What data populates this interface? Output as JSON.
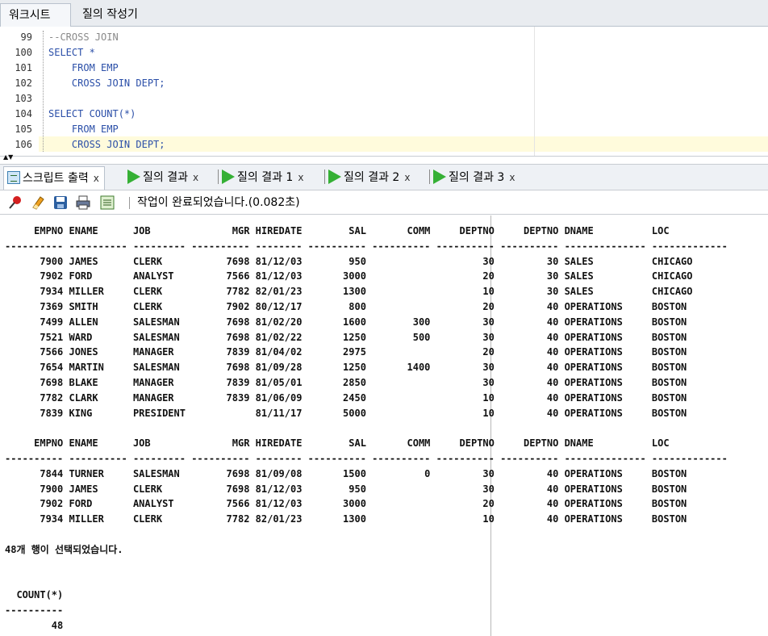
{
  "top_tabs": {
    "worksheet": "워크시트",
    "query_builder": "질의 작성기"
  },
  "editor": {
    "lines": [
      {
        "num": "99",
        "code": "--CROSS JOIN"
      },
      {
        "num": "100",
        "code": "SELECT *"
      },
      {
        "num": "101",
        "code": "    FROM EMP"
      },
      {
        "num": "102",
        "code": "    CROSS JOIN DEPT;"
      },
      {
        "num": "103",
        "code": ""
      },
      {
        "num": "104",
        "code": "SELECT COUNT(*)"
      },
      {
        "num": "105",
        "code": "    FROM EMP"
      },
      {
        "num": "106",
        "code": "    CROSS JOIN DEPT;"
      }
    ]
  },
  "output_tabs": [
    {
      "label": "스크립트 출력",
      "close": "x"
    },
    {
      "label": "질의 결과",
      "close": "x"
    },
    {
      "label": "질의 결과 1",
      "close": "x"
    },
    {
      "label": "질의 결과 2",
      "close": "x"
    },
    {
      "label": "질의 결과 3",
      "close": "x"
    }
  ],
  "toolbar": {
    "status": "작업이 완료되었습니다.(0.082초)"
  },
  "output_lines": [
    "     EMPNO ENAME      JOB              MGR HIREDATE        SAL       COMM     DEPTNO     DEPTNO DNAME          LOC          ",
    "---------- ---------- --------- ---------- -------- ---------- ---------- ---------- ---------- -------------- -------------",
    "      7900 JAMES      CLERK           7698 81/12/03        950                    30         30 SALES          CHICAGO      ",
    "      7902 FORD       ANALYST         7566 81/12/03       3000                    20         30 SALES          CHICAGO      ",
    "      7934 MILLER     CLERK           7782 82/01/23       1300                    10         30 SALES          CHICAGO      ",
    "      7369 SMITH      CLERK           7902 80/12/17        800                    20         40 OPERATIONS     BOSTON       ",
    "      7499 ALLEN      SALESMAN        7698 81/02/20       1600        300         30         40 OPERATIONS     BOSTON       ",
    "      7521 WARD       SALESMAN        7698 81/02/22       1250        500         30         40 OPERATIONS     BOSTON       ",
    "      7566 JONES      MANAGER         7839 81/04/02       2975                    20         40 OPERATIONS     BOSTON       ",
    "      7654 MARTIN     SALESMAN        7698 81/09/28       1250       1400         30         40 OPERATIONS     BOSTON       ",
    "      7698 BLAKE      MANAGER         7839 81/05/01       2850                    30         40 OPERATIONS     BOSTON       ",
    "      7782 CLARK      MANAGER         7839 81/06/09       2450                    10         40 OPERATIONS     BOSTON       ",
    "      7839 KING       PRESIDENT            81/11/17       5000                    10         40 OPERATIONS     BOSTON       ",
    "",
    "     EMPNO ENAME      JOB              MGR HIREDATE        SAL       COMM     DEPTNO     DEPTNO DNAME          LOC          ",
    "---------- ---------- --------- ---------- -------- ---------- ---------- ---------- ---------- -------------- -------------",
    "      7844 TURNER     SALESMAN        7698 81/09/08       1500          0         30         40 OPERATIONS     BOSTON       ",
    "      7900 JAMES      CLERK           7698 81/12/03        950                    30         40 OPERATIONS     BOSTON       ",
    "      7902 FORD       ANALYST         7566 81/12/03       3000                    20         40 OPERATIONS     BOSTON       ",
    "      7934 MILLER     CLERK           7782 82/01/23       1300                    10         40 OPERATIONS     BOSTON       ",
    "",
    "48개 행이 선택되었습니다.",
    "",
    "",
    "  COUNT(*)",
    "----------",
    "        48"
  ]
}
